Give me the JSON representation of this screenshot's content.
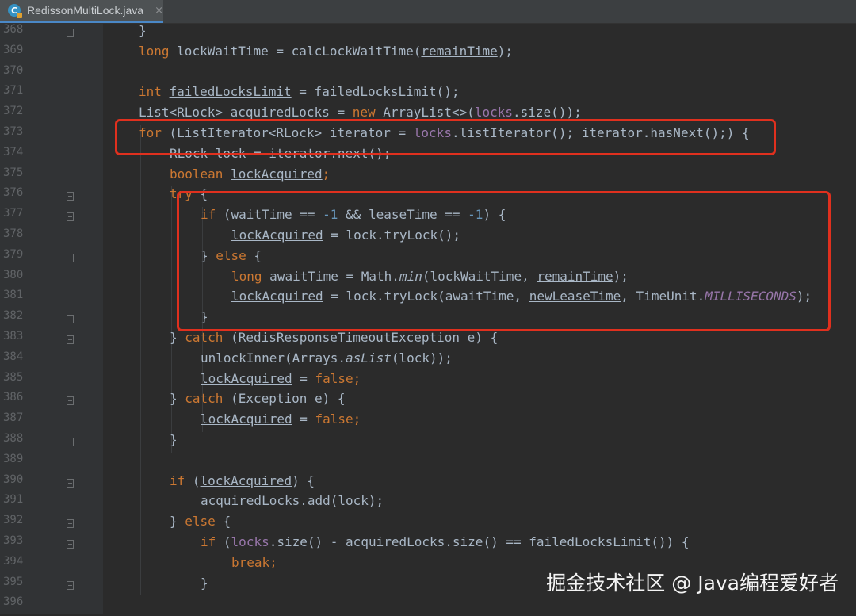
{
  "tab": {
    "title": "RedissonMultiLock.java",
    "icon_letter": "C",
    "close": "×"
  },
  "lines": [
    {
      "no": "368",
      "fold": "open",
      "indent": 0,
      "tokens": [
        [
          "p",
          "}"
        ]
      ]
    },
    {
      "no": "369",
      "fold": "",
      "indent": 0,
      "tokens": [
        [
          "k",
          "long "
        ],
        [
          "p",
          "lockWaitTime = calcLockWaitTime("
        ],
        [
          "u",
          "remainTime"
        ],
        [
          "p",
          ");"
        ]
      ]
    },
    {
      "no": "370",
      "fold": "",
      "indent": 0,
      "tokens": []
    },
    {
      "no": "371",
      "fold": "",
      "indent": 0,
      "tokens": [
        [
          "k",
          "int "
        ],
        [
          "u",
          "failedLocksLimit"
        ],
        [
          "p",
          " = failedLocksLimit();"
        ]
      ]
    },
    {
      "no": "372",
      "fold": "",
      "indent": 0,
      "tokens": [
        [
          "p",
          "List<RLock> acquiredLocks = "
        ],
        [
          "k",
          "new "
        ],
        [
          "p",
          "ArrayList<>("
        ],
        [
          "f",
          "locks"
        ],
        [
          "p",
          ".size());"
        ]
      ]
    },
    {
      "no": "373",
      "fold": "",
      "indent": 0,
      "tokens": [
        [
          "k",
          "for "
        ],
        [
          "p",
          "(ListIterator<RLock> iterator = "
        ],
        [
          "f",
          "locks"
        ],
        [
          "p",
          ".listIterator(); iterator.hasNext();) {"
        ]
      ]
    },
    {
      "no": "374",
      "fold": "",
      "indent": 1,
      "tokens": [
        [
          "p",
          "RLock lock = iterator.next();"
        ]
      ]
    },
    {
      "no": "375",
      "fold": "",
      "indent": 1,
      "tokens": [
        [
          "k",
          "boolean "
        ],
        [
          "u",
          "lockAcquired"
        ],
        [
          "k",
          ";"
        ]
      ]
    },
    {
      "no": "376",
      "fold": "open",
      "indent": 1,
      "tokens": [
        [
          "k",
          "try "
        ],
        [
          "p",
          "{"
        ]
      ]
    },
    {
      "no": "377",
      "fold": "open",
      "indent": 2,
      "tokens": [
        [
          "k",
          "if "
        ],
        [
          "p",
          "(waitTime == "
        ],
        [
          "n",
          "-1 "
        ],
        [
          "p",
          "&& leaseTime == "
        ],
        [
          "n",
          "-1"
        ],
        [
          "p",
          ") {"
        ]
      ]
    },
    {
      "no": "378",
      "fold": "",
      "indent": 3,
      "tokens": [
        [
          "u",
          "lockAcquired"
        ],
        [
          "p",
          " = lock.tryLock();"
        ]
      ]
    },
    {
      "no": "379",
      "fold": "open",
      "indent": 2,
      "tokens": [
        [
          "p",
          "} "
        ],
        [
          "k",
          "else "
        ],
        [
          "p",
          "{"
        ]
      ]
    },
    {
      "no": "380",
      "fold": "",
      "indent": 3,
      "tokens": [
        [
          "k",
          "long "
        ],
        [
          "p",
          "awaitTime = Math."
        ],
        [
          "i",
          "min"
        ],
        [
          "p",
          "(lockWaitTime, "
        ],
        [
          "u",
          "remainTime"
        ],
        [
          "p",
          ");"
        ]
      ]
    },
    {
      "no": "381",
      "fold": "",
      "indent": 3,
      "tokens": [
        [
          "u",
          "lockAcquired"
        ],
        [
          "p",
          " = lock.tryLock(awaitTime, "
        ],
        [
          "u",
          "newLeaseTime"
        ],
        [
          "p",
          ", TimeUnit."
        ],
        [
          "fs",
          "MILLISECONDS"
        ],
        [
          "p",
          ");"
        ]
      ]
    },
    {
      "no": "382",
      "fold": "open",
      "indent": 2,
      "tokens": [
        [
          "p",
          "}"
        ]
      ]
    },
    {
      "no": "383",
      "fold": "open",
      "indent": 1,
      "tokens": [
        [
          "p",
          "} "
        ],
        [
          "k",
          "catch "
        ],
        [
          "p",
          "(RedisResponseTimeoutException e) {"
        ]
      ]
    },
    {
      "no": "384",
      "fold": "",
      "indent": 2,
      "tokens": [
        [
          "p",
          "unlockInner(Arrays."
        ],
        [
          "i",
          "asList"
        ],
        [
          "p",
          "(lock));"
        ]
      ]
    },
    {
      "no": "385",
      "fold": "",
      "indent": 2,
      "tokens": [
        [
          "u",
          "lockAcquired"
        ],
        [
          "p",
          " = "
        ],
        [
          "k",
          "false;"
        ]
      ]
    },
    {
      "no": "386",
      "fold": "open",
      "indent": 1,
      "tokens": [
        [
          "p",
          "} "
        ],
        [
          "k",
          "catch "
        ],
        [
          "p",
          "(Exception e) {"
        ]
      ]
    },
    {
      "no": "387",
      "fold": "",
      "indent": 2,
      "tokens": [
        [
          "u",
          "lockAcquired"
        ],
        [
          "p",
          " = "
        ],
        [
          "k",
          "false;"
        ]
      ]
    },
    {
      "no": "388",
      "fold": "open",
      "indent": 1,
      "tokens": [
        [
          "p",
          "}"
        ]
      ]
    },
    {
      "no": "389",
      "fold": "",
      "indent": 0,
      "tokens": []
    },
    {
      "no": "390",
      "fold": "open",
      "indent": 1,
      "tokens": [
        [
          "k",
          "if "
        ],
        [
          "p",
          "("
        ],
        [
          "u",
          "lockAcquired"
        ],
        [
          "p",
          ") {"
        ]
      ]
    },
    {
      "no": "391",
      "fold": "",
      "indent": 2,
      "tokens": [
        [
          "p",
          "acquiredLocks.add(lock);"
        ]
      ]
    },
    {
      "no": "392",
      "fold": "open",
      "indent": 1,
      "tokens": [
        [
          "p",
          "} "
        ],
        [
          "k",
          "else "
        ],
        [
          "p",
          "{"
        ]
      ]
    },
    {
      "no": "393",
      "fold": "open",
      "indent": 2,
      "tokens": [
        [
          "k",
          "if "
        ],
        [
          "p",
          "("
        ],
        [
          "f",
          "locks"
        ],
        [
          "p",
          ".size() - acquiredLocks.size() == failedLocksLimit()) {"
        ]
      ]
    },
    {
      "no": "394",
      "fold": "",
      "indent": 3,
      "tokens": [
        [
          "k",
          "break;"
        ]
      ]
    },
    {
      "no": "395",
      "fold": "open",
      "indent": 2,
      "tokens": [
        [
          "p",
          "}"
        ]
      ]
    },
    {
      "no": "396",
      "fold": "",
      "indent": 0,
      "tokens": []
    }
  ],
  "watermark": "掘金技术社区 @ Java编程爱好者",
  "colors": {
    "keyword": "#cc7832",
    "field": "#9876aa",
    "number": "#6897bb",
    "plain": "#a9b7c6",
    "highlight": "#e0301e"
  }
}
